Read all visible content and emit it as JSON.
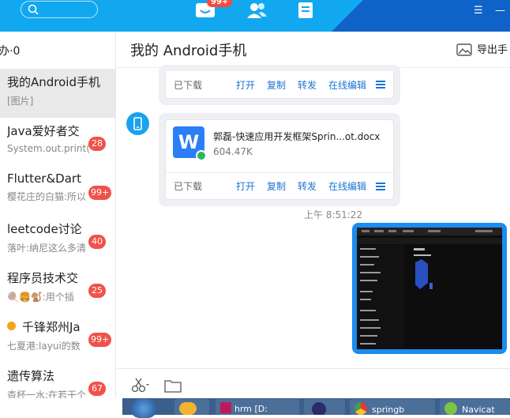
{
  "topbar": {
    "badge": "99+"
  },
  "sidebar": {
    "header": "办·0",
    "conversations": [
      {
        "name": "我的Android手机",
        "preview": "[图片]",
        "count": ""
      },
      {
        "name": "Java爱好者交",
        "preview": "System.out.print(\"",
        "count": "28"
      },
      {
        "name": "Flutter&Dart",
        "preview": "樱花庄的白猫:所以",
        "count": "99+"
      },
      {
        "name": "leetcode讨论",
        "preview": "落叶:纳尼这么多清",
        "count": "40"
      },
      {
        "name": "程序员技术交",
        "preview": ":用个插",
        "count": "25"
      },
      {
        "name": "千锋郑州Ja",
        "preview": "七夏港:layui的数",
        "count": "99+"
      },
      {
        "name": "遗传算法",
        "preview": "杳杯一水:在若干个",
        "count": "67"
      }
    ]
  },
  "chat": {
    "title": "我的 Android手机",
    "export_label": "导出手",
    "msg1": {
      "status": "已下载",
      "actions": [
        "打开",
        "复制",
        "转发",
        "在线编辑"
      ]
    },
    "msg2": {
      "filename": "郭磊-快速应用开发框架Sprin...ot.docx",
      "size": "604.47K",
      "status": "已下载",
      "actions": [
        "打开",
        "复制",
        "转发",
        "在线编辑"
      ]
    },
    "timestamp": "上午 8:51:22"
  },
  "taskbar": {
    "items": [
      "hrm [D:",
      "",
      "springb",
      "Navicat"
    ]
  },
  "colors": {
    "topbar": "#12a8f0",
    "accent": "#1a73d4",
    "badge": "#f0524a",
    "image_border": "#1b8cf0"
  }
}
